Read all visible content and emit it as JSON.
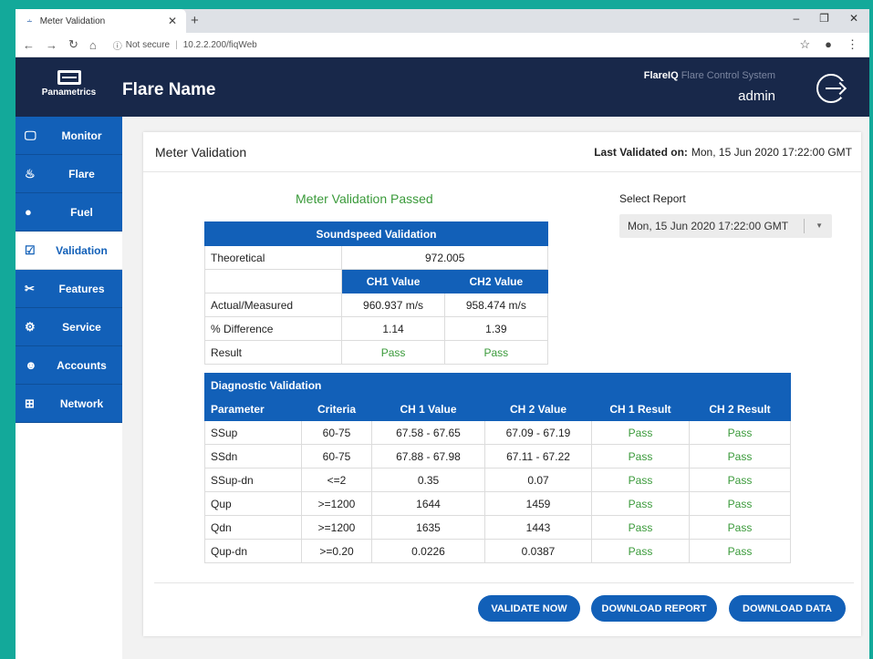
{
  "browser": {
    "tab_title": "Meter Validation",
    "url_status": "Not secure",
    "url": "10.2.2.200/fiqWeb"
  },
  "header": {
    "logo_text": "Panametrics",
    "flare_name": "Flare Name",
    "brand": "FlareIQ",
    "system_name": "Flare Control System",
    "user": "admin"
  },
  "sidebar": {
    "items": [
      {
        "label": "Monitor",
        "icon": "monitor-icon"
      },
      {
        "label": "Flare",
        "icon": "flame-icon"
      },
      {
        "label": "Fuel",
        "icon": "drop-icon"
      },
      {
        "label": "Validation",
        "icon": "clipboard-check-icon"
      },
      {
        "label": "Features",
        "icon": "tools-icon"
      },
      {
        "label": "Service",
        "icon": "gears-icon"
      },
      {
        "label": "Accounts",
        "icon": "users-icon"
      },
      {
        "label": "Network",
        "icon": "network-icon"
      }
    ],
    "active": "Validation"
  },
  "card": {
    "title": "Meter Validation",
    "last_validated_label": "Last Validated on:",
    "last_validated_value": "Mon, 15 Jun 2020 17:22:00 GMT",
    "status_message": "Meter Validation Passed",
    "select_label": "Select Report",
    "select_value": "Mon, 15 Jun 2020 17:22:00 GMT"
  },
  "soundspeed": {
    "title": "Soundspeed Validation",
    "theoretical_label": "Theoretical",
    "theoretical_value": "972.005",
    "ch1_header": "CH1 Value",
    "ch2_header": "CH2 Value",
    "rows": [
      {
        "label": "Actual/Measured",
        "ch1": "960.937 m/s",
        "ch2": "958.474 m/s"
      },
      {
        "label": "% Difference",
        "ch1": "1.14",
        "ch2": "1.39"
      },
      {
        "label": "Result",
        "ch1": "Pass",
        "ch2": "Pass"
      }
    ]
  },
  "diagnostic": {
    "title": "Diagnostic Validation",
    "headers": [
      "Parameter",
      "Criteria",
      "CH 1 Value",
      "CH 2 Value",
      "CH 1 Result",
      "CH 2 Result"
    ],
    "rows": [
      [
        "SSup",
        "60-75",
        "67.58 - 67.65",
        "67.09 - 67.19",
        "Pass",
        "Pass"
      ],
      [
        "SSdn",
        "60-75",
        "67.88 - 67.98",
        "67.11 - 67.22",
        "Pass",
        "Pass"
      ],
      [
        "SSup-dn",
        "<=2",
        "0.35",
        "0.07",
        "Pass",
        "Pass"
      ],
      [
        "Qup",
        ">=1200",
        "1644",
        "1459",
        "Pass",
        "Pass"
      ],
      [
        "Qdn",
        ">=1200",
        "1635",
        "1443",
        "Pass",
        "Pass"
      ],
      [
        "Qup-dn",
        ">=0.20",
        "0.0226",
        "0.0387",
        "Pass",
        "Pass"
      ]
    ]
  },
  "actions": {
    "validate": "VALIDATE NOW",
    "download_report": "DOWNLOAD REPORT",
    "download_data": "DOWNLOAD DATA"
  }
}
